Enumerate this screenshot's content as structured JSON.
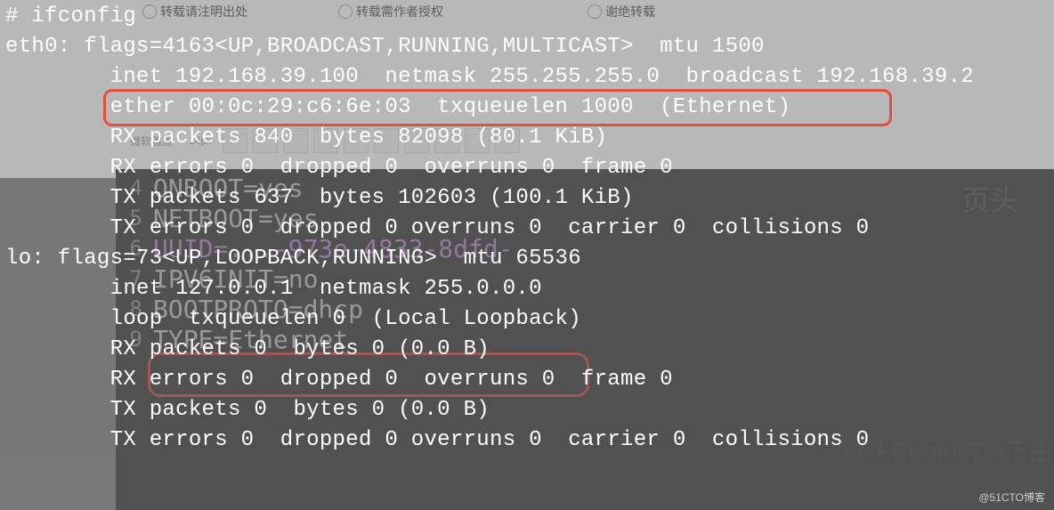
{
  "bg": {
    "radios": [
      "转载请注明出处",
      "转载需作者授权",
      "谢绝转载"
    ],
    "toolbar_label": "微软雅黑",
    "editor_lines": [
      {
        "n": "4",
        "t": "ONBOOT=yes",
        "cls": ""
      },
      {
        "n": "5",
        "t": "NETBOOT=yes",
        "cls": ""
      },
      {
        "n": "6",
        "t": "UUID=...-973e-4833-8dfd-",
        "cls": "purple"
      },
      {
        "n": "7",
        "t": "IPV6INIT=no",
        "cls": ""
      },
      {
        "n": "8",
        "t": "BOOTPROTO=dhcp",
        "cls": ""
      },
      {
        "n": "9",
        "t": "TYPE=Ethernet",
        "cls": ""
      }
    ],
    "side": "解决Centos7.4下由",
    "cn_header": "页头"
  },
  "terminal": {
    "lines": [
      "# ifconfig",
      "eth0: flags=4163<UP,BROADCAST,RUNNING,MULTICAST>  mtu 1500",
      "        inet 192.168.39.100  netmask 255.255.255.0  broadcast 192.168.39.2",
      "        ether 00:0c:29:c6:6e:03  txqueuelen 1000  (Ethernet)",
      "        RX packets 840  bytes 82098 (80.1 KiB)",
      "        RX errors 0  dropped 0  overruns 0  frame 0",
      "        TX packets 637  bytes 102603 (100.1 KiB)",
      "        TX errors 0  dropped 0 overruns 0  carrier 0  collisions 0",
      "",
      "lo: flags=73<UP,LOOPBACK,RUNNING>  mtu 65536",
      "        inet 127.0.0.1  netmask 255.0.0.0",
      "        loop  txqueuelen 0  (Local Loopback)",
      "        RX packets 0  bytes 0 (0.0 B)",
      "        RX errors 0  dropped 0  overruns 0  frame 0",
      "        TX packets 0  bytes 0 (0.0 B)",
      "        TX errors 0  dropped 0 overruns 0  carrier 0  collisions 0"
    ]
  },
  "watermark": "@51CTO博客"
}
